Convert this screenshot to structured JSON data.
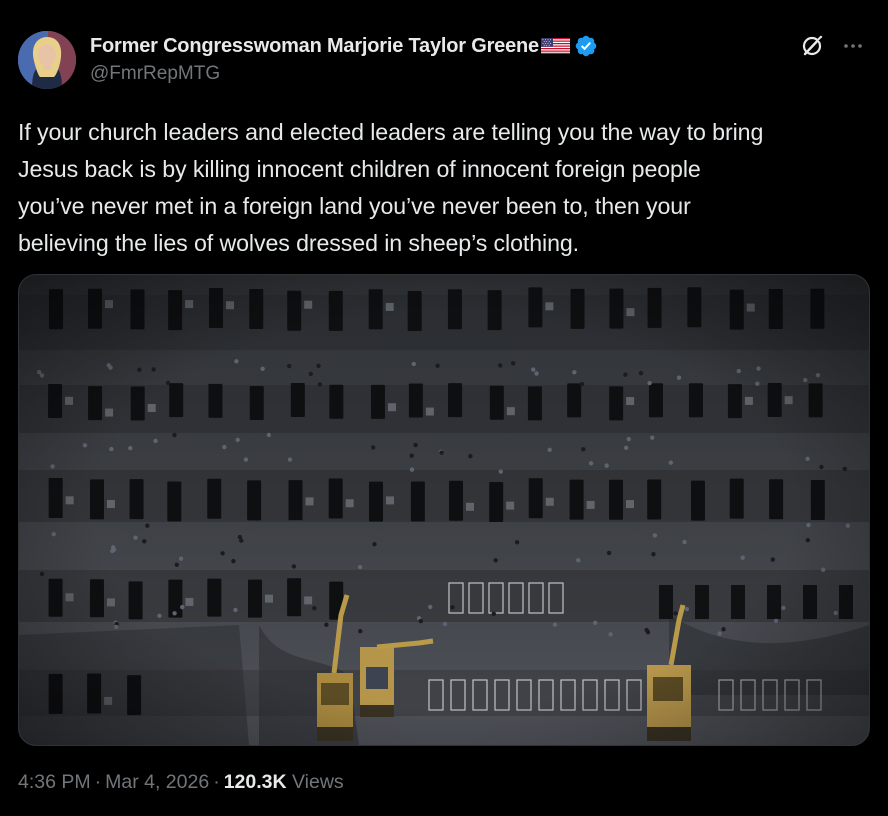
{
  "author": {
    "display_name": "Former Congresswoman Marjorie Taylor Greene",
    "handle": "@FmrRepMTG",
    "verified": true,
    "flag_emoji": "us-flag-icon"
  },
  "post": {
    "text": "If your church leaders and elected leaders are telling you the way to bring\nJesus back is by killing innocent children of innocent foreign people\nyou’ve never met in a foreign land you’ve never been to, then your\nbelieving the lies of wolves dressed in sheep’s clothing.",
    "media": {
      "type": "photo",
      "icon": "aerial-photo-of-graves"
    }
  },
  "meta": {
    "time": "4:36 PM",
    "separator": "·",
    "date": "Mar 4, 2026",
    "views_count": "120.3K",
    "views_label": "Views"
  },
  "colors": {
    "background": "#000000",
    "text_primary": "#e7e9ea",
    "text_secondary": "#71767b",
    "verified_blue": "#1d9bf0",
    "border": "#2f3336"
  }
}
